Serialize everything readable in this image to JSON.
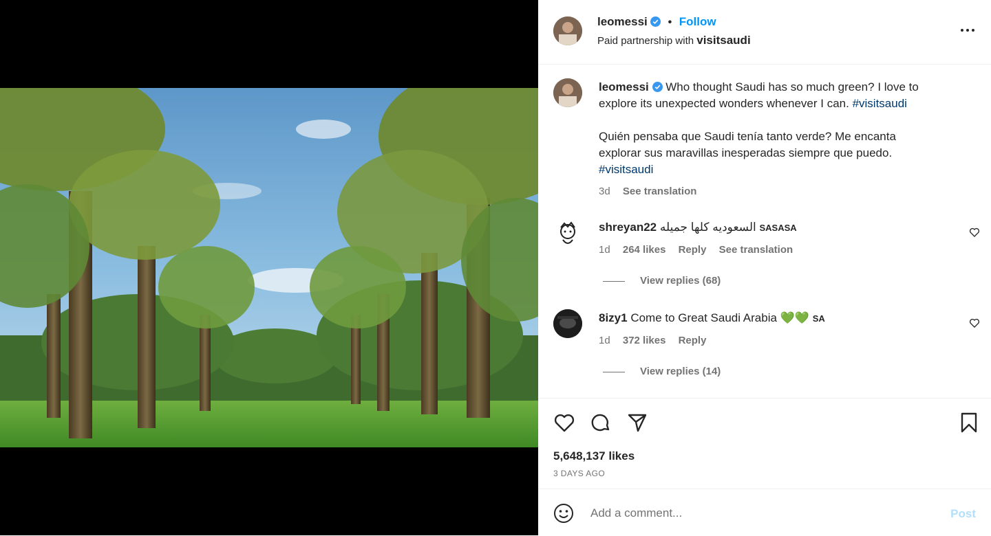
{
  "post": {
    "username": "leomessi",
    "follow_label": "Follow",
    "partnership_prefix": "Paid partnership with",
    "partner": "visitsaudi",
    "caption_line1": "Who thought Saudi has so much green? I love to",
    "caption_line2": "explore its unexpected wonders whenever I can.",
    "caption_hashtag": "#visitsaudi",
    "caption_es_line1": "Quién pensaba que Saudi tenía tanto verde? Me encanta",
    "caption_es_line2": "explorar sus maravillas inesperadas siempre que puedo.",
    "caption_es_hashtag": "#visitsaudi",
    "time": "3d",
    "see_translation": "See translation",
    "likes": "5,648,137 likes",
    "date": "3 DAYS AGO"
  },
  "comments": [
    {
      "username": "shreyan22",
      "text": "السعوديه كلها جميله",
      "flag": "SASASA",
      "time": "1d",
      "likes": "264 likes",
      "reply": "Reply",
      "see_translation": "See translation",
      "view_replies": "View replies (68)"
    },
    {
      "username": "8izy1",
      "text": "Come to Great Saudi Arabia",
      "hearts": "💚💚",
      "flag": "SA",
      "time": "1d",
      "likes": "372 likes",
      "reply": "Reply",
      "view_replies": "View replies (14)"
    }
  ],
  "composer": {
    "placeholder": "Add a comment...",
    "post_label": "Post"
  },
  "icons": [
    "more-icon",
    "like-icon",
    "comment-icon",
    "share-icon",
    "save-icon",
    "emoji-icon",
    "verified-icon"
  ],
  "colors": {
    "accent": "#0095f6",
    "hashtag": "#00376b",
    "muted": "#737373",
    "post_disabled": "#b2dffc"
  }
}
